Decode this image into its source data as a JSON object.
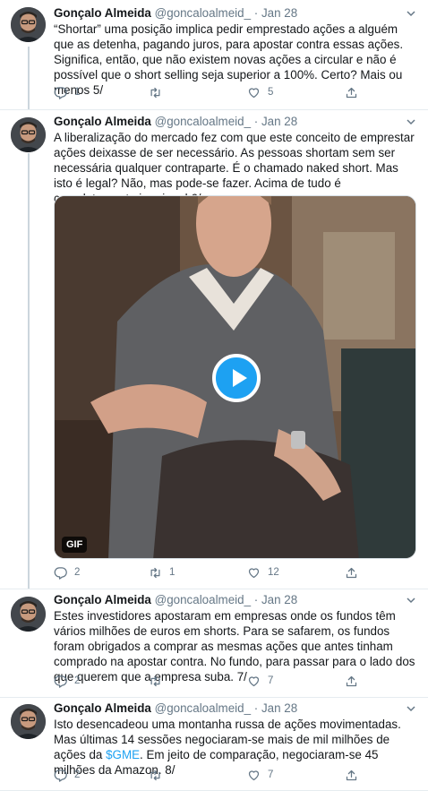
{
  "tweets": [
    {
      "author": "Gonçalo Almeida",
      "handle": "@goncaloalmeid_",
      "separator": "·",
      "date": "Jan 28",
      "text": "“Shortar” uma posição implica pedir emprestado ações a alguém que as detenha, pagando juros, para apostar contra essas ações. Significa, então, que não existem novas ações a circular e não é possível que o short selling seja superior a 100%. Certo? Mais ou menos 5/",
      "replies": "1",
      "retweets": "",
      "likes": "5"
    },
    {
      "author": "Gonçalo Almeida",
      "handle": "@goncaloalmeid_",
      "separator": "·",
      "date": "Jan 28",
      "text": "A liberalização do mercado fez com que este conceito de emprestar ações deixasse de ser necessário. As pessoas shortam sem ser necessária qualquer contraparte. É o chamado naked short. Mas isto é legal? Não, mas pode-se fazer. Acima de tudo é completamente irracional 6/",
      "media_badge": "GIF",
      "replies": "2",
      "retweets": "1",
      "likes": "12"
    },
    {
      "author": "Gonçalo Almeida",
      "handle": "@goncaloalmeid_",
      "separator": "·",
      "date": "Jan 28",
      "text": "Estes investidores apostaram em empresas onde os fundos têm vários milhões de euros em shorts. Para se safarem, os fundos foram obrigados a comprar as mesmas ações que antes tinham comprado na apostar contra. No fundo, para passar para o lado dos que querem que a empresa suba. 7/",
      "replies": "2",
      "retweets": "",
      "likes": "7"
    },
    {
      "author": "Gonçalo Almeida",
      "handle": "@goncaloalmeid_",
      "separator": "·",
      "date": "Jan 28",
      "text_before": "Isto desencadeou uma montanha russa de ações movimentadas. Mas últimas 14 sessões negociaram-se mais de mil milhões de ações da ",
      "cashtag": "$GME",
      "text_after": ". Em jeito de comparação, negociaram-se 45 milhões da Amazon. 8/",
      "replies": "2",
      "retweets": "",
      "likes": "7"
    }
  ],
  "colors": {
    "accent": "#1da1f2",
    "secondary_text": "#657786",
    "divider": "#e6ecf0",
    "thread_line": "#ccd6dd"
  },
  "icons": {
    "reply": "reply-icon",
    "retweet": "retweet-icon",
    "like": "heart-icon",
    "share": "share-icon",
    "more": "chevron-down-icon",
    "play": "play-icon"
  }
}
